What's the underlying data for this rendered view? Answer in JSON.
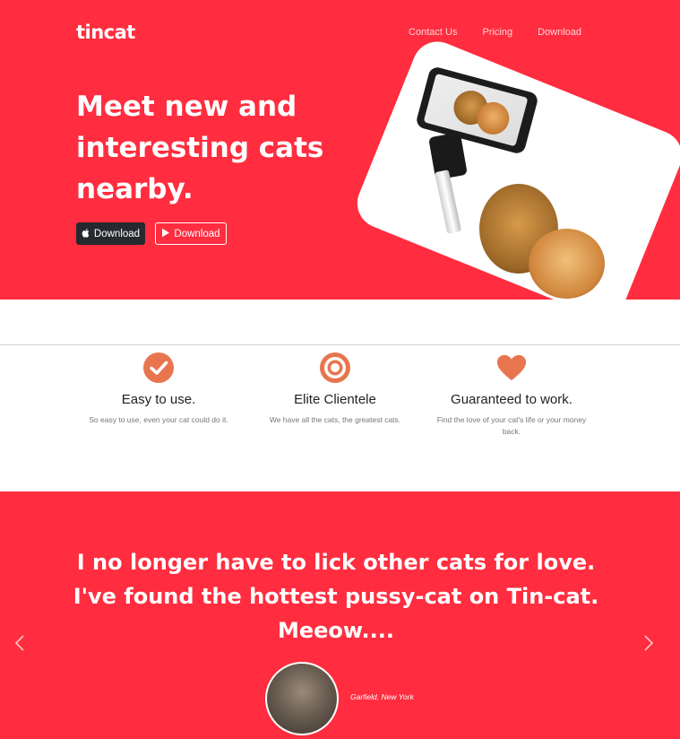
{
  "header": {
    "brand": "tincat",
    "nav": [
      "Contact Us",
      "Pricing",
      "Download"
    ]
  },
  "hero": {
    "headline": "Meet new and interesting cats nearby.",
    "buttons": [
      {
        "label": "Download",
        "icon": "apple-icon"
      },
      {
        "label": "Download",
        "icon": "play-store-icon"
      }
    ]
  },
  "features": [
    {
      "icon": "check-circle-icon",
      "title": "Easy to use.",
      "text": "So easy to use, even your cat could do it."
    },
    {
      "icon": "target-icon",
      "title": "Elite Clientele",
      "text": "We have all the cats, the greatest cats."
    },
    {
      "icon": "heart-icon",
      "title": "Guaranteed to work.",
      "text": "Find the love of your cat's life or your money back."
    }
  ],
  "testimonial": {
    "quote": "I no longer have to lick other cats for love. I've found the hottest pussy-cat on Tin-cat. Meeow....",
    "author": "Garfield, New York"
  },
  "colors": {
    "brand_red": "#ff2d3f",
    "icon_orange": "#e8754e",
    "dark_button": "#26292e"
  }
}
